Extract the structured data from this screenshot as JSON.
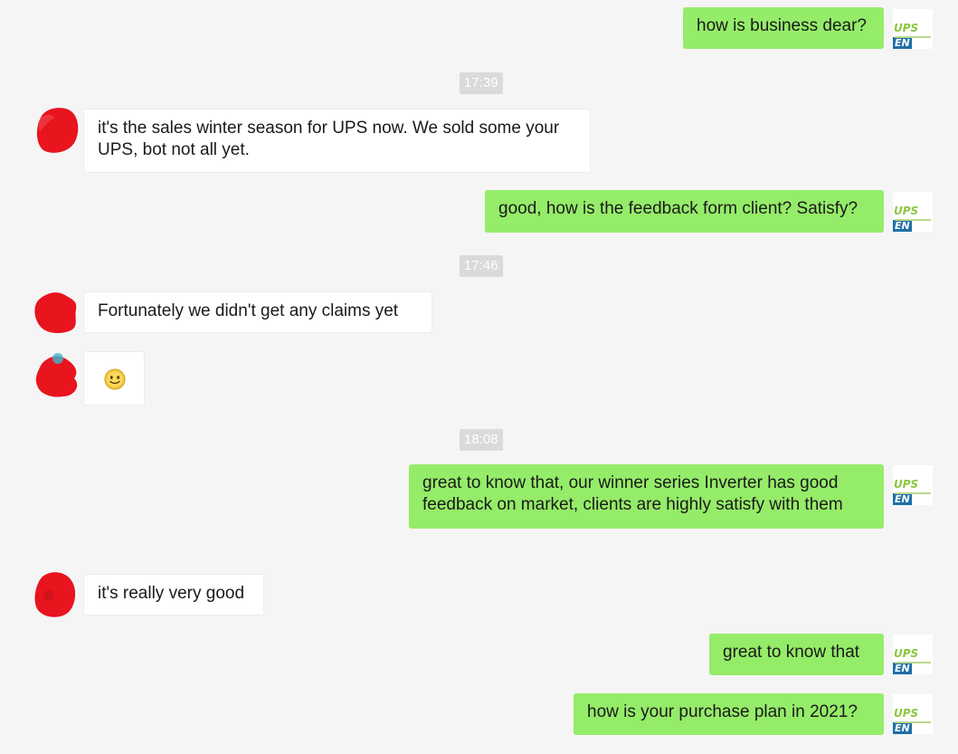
{
  "conversation": {
    "messages": [
      {
        "id": "m1",
        "direction": "outgoing",
        "lines": [
          "how is business dear?"
        ]
      },
      {
        "id": "t1",
        "type": "timestamp",
        "text": "17:39"
      },
      {
        "id": "m2",
        "direction": "incoming",
        "lines": [
          "it's the sales winter season for UPS now. We sold some your",
          "UPS, bot not all yet."
        ]
      },
      {
        "id": "m3",
        "direction": "outgoing",
        "lines": [
          "good, how is the feedback form client? Satisfy?"
        ]
      },
      {
        "id": "t2",
        "type": "timestamp",
        "text": "17:46"
      },
      {
        "id": "m4",
        "direction": "incoming",
        "lines": [
          "Fortunately we didn't get any claims yet"
        ]
      },
      {
        "id": "m5",
        "direction": "incoming",
        "type": "emoji",
        "emoji": "smile-emoji"
      },
      {
        "id": "t3",
        "type": "timestamp",
        "text": "18:08"
      },
      {
        "id": "m6",
        "direction": "outgoing",
        "lines": [
          "great to know that, our winner series Inverter has good",
          "feedback on market, clients are highly satisfy with them"
        ]
      },
      {
        "id": "m7",
        "direction": "incoming",
        "lines": [
          "it's really very good"
        ]
      },
      {
        "id": "m8",
        "direction": "outgoing",
        "lines": [
          "great to know that"
        ]
      },
      {
        "id": "m9",
        "direction": "outgoing",
        "lines": [
          "how is your purchase plan in 2021?"
        ]
      }
    ]
  },
  "self_avatar": {
    "logo_text": "UPS",
    "logo_suffix": "EN"
  },
  "colors": {
    "background": "#f5f5f5",
    "outgoing_bubble": "#95ec69",
    "incoming_bubble": "#ffffff",
    "timestamp_bg": "#dadada",
    "contact_avatar": "#e8141e",
    "logo_green": "#8cc63f",
    "logo_blue": "#1e6fa5"
  }
}
